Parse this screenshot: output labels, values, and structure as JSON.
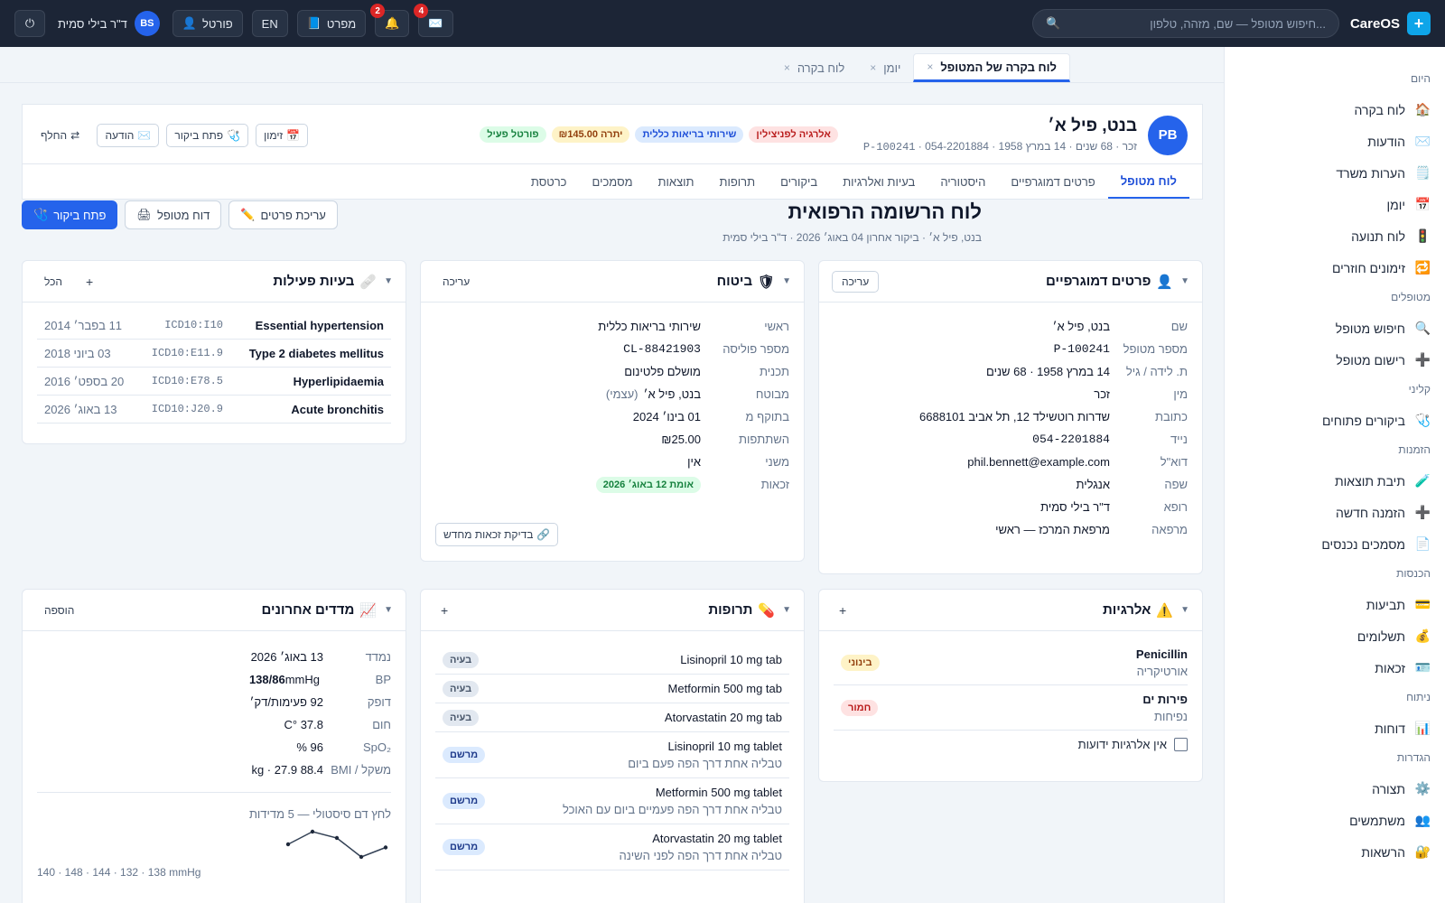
{
  "topbar": {
    "brand": "CareOS",
    "brand_logo": "plus-icon",
    "search_placeholder": "חיפוש מטופל — שם, מזהה, טלפון...",
    "messages_count": "4",
    "notifications_count": "2",
    "handbook_label": "מפרט",
    "lang_label": "EN",
    "portal_label": "פורטל",
    "user_name": "ד\"ר בילי סמית",
    "user_initials": "BS"
  },
  "window_tabs": [
    {
      "label": "לוח בקרה של המטופל",
      "active": true
    },
    {
      "label": "יומן",
      "active": false
    },
    {
      "label": "לוח בקרה",
      "active": false
    }
  ],
  "sidebar": {
    "sections": [
      {
        "title": "היום",
        "items": [
          {
            "label": "לוח בקרה",
            "icon": "🏠"
          },
          {
            "label": "הודעות",
            "icon": "✉️"
          },
          {
            "label": "הערות משרד",
            "icon": "🗒️"
          },
          {
            "label": "יומן",
            "icon": "📅"
          },
          {
            "label": "לוח תנועה",
            "icon": "🚦"
          },
          {
            "label": "זימונים חוזרים",
            "icon": "🔁"
          }
        ]
      },
      {
        "title": "מטופלים",
        "items": [
          {
            "label": "חיפוש מטופל",
            "icon": "🔍"
          },
          {
            "label": "רישום מטופל",
            "icon": "➕"
          }
        ]
      },
      {
        "title": "קליני",
        "items": [
          {
            "label": "ביקורים פתוחים",
            "icon": "🩺"
          }
        ]
      },
      {
        "title": "הזמנות",
        "items": [
          {
            "label": "תיבת תוצאות",
            "icon": "🧪"
          },
          {
            "label": "הזמנה חדשה",
            "icon": "➕"
          },
          {
            "label": "מסמכים נכנסים",
            "icon": "📄"
          }
        ]
      },
      {
        "title": "הכנסות",
        "items": [
          {
            "label": "תביעות",
            "icon": "💳"
          },
          {
            "label": "תשלומים",
            "icon": "💰"
          },
          {
            "label": "זכאות",
            "icon": "🪪"
          }
        ]
      },
      {
        "title": "ניתוח",
        "items": [
          {
            "label": "דוחות",
            "icon": "📊"
          }
        ]
      },
      {
        "title": "הגדרות",
        "items": [
          {
            "label": "תצורה",
            "icon": "⚙️"
          },
          {
            "label": "משתמשים",
            "icon": "👥"
          },
          {
            "label": "הרשאות",
            "icon": "🔐"
          }
        ]
      }
    ]
  },
  "patient": {
    "initials": "PB",
    "name": "בנט, פיל א׳",
    "sex": "זכר",
    "age": "68 שנים",
    "dob": "14 במרץ 1958",
    "mrn": "P-100241",
    "phone": "054-2201884",
    "tags": {
      "allergy": "אלרגיה לפניצילין",
      "insurer": "שירותי בריאות כללית",
      "balance": "יתרה ₪145.00",
      "portal": "פורטל פעיל"
    },
    "actions": {
      "schedule": "זימון",
      "open_visit": "פתח ביקור",
      "message": "הודעה",
      "switch": "החלף"
    }
  },
  "nav_tabs": [
    "לוח מטופל",
    "פרטים דמוגרפיים",
    "היסטוריה",
    "בעיות ואלרגיות",
    "ביקורים",
    "תרופות",
    "תוצאות",
    "מסמכים",
    "כרטסת"
  ],
  "page": {
    "title": "לוח הרשומה הרפואית",
    "subtitle": "בנט, פיל א׳ · ביקור אחרון 04 באוג׳ 2026 · ד\"ר בילי סמית",
    "edit_details": "עריכת פרטים",
    "patient_report": "דוח מטופל",
    "open_visit": "פתח ביקור"
  },
  "demographics": {
    "title": "פרטים דמוגרפיים",
    "edit": "עריכה",
    "rows": [
      {
        "k": "שם",
        "v": "בנט, פיל א׳"
      },
      {
        "k": "מספר מטופל",
        "v": "P-100241"
      },
      {
        "k": "ת. לידה / גיל",
        "v": "14 במרץ 1958 · 68 שנים"
      },
      {
        "k": "מין",
        "v": "זכר"
      },
      {
        "k": "כתובת",
        "v": "שדרות רוטשילד 12, תל אביב 6688101"
      },
      {
        "k": "נייד",
        "v": "054-2201884"
      },
      {
        "k": "דוא\"ל",
        "v": "phil.bennett@example.com"
      },
      {
        "k": "שפה",
        "v": "אנגלית"
      },
      {
        "k": "רופא",
        "v": "ד\"ר בילי סמית"
      },
      {
        "k": "מרפאה",
        "v": "מרפאת המרכז — ראשי"
      }
    ]
  },
  "insurance": {
    "title": "ביטוח",
    "edit": "עריכה",
    "rows": [
      {
        "k": "ראשי",
        "v": "שירותי בריאות כללית"
      },
      {
        "k": "מספר פוליסה",
        "v": "CL-88421903"
      },
      {
        "k": "תכנית",
        "v": "מושלם פלטינום"
      },
      {
        "k": "מבוטח",
        "v": "בנט, פיל א׳",
        "extra": "(עצמי)"
      },
      {
        "k": "בתוקף מ",
        "v": "01 בינו׳ 2024"
      },
      {
        "k": "השתתפות",
        "v": "₪25.00"
      },
      {
        "k": "משני",
        "v": "אין"
      },
      {
        "k": "זכאות",
        "v": "אומת 12 באוג׳ 2026"
      }
    ],
    "recheck": "בדיקת זכאות מחדש"
  },
  "problems": {
    "title": "בעיות פעילות",
    "all": "הכל",
    "rows": [
      {
        "name": "Essential hypertension",
        "code": "ICD10:I10",
        "date": "11 בפבר׳ 2014"
      },
      {
        "name": "Type 2 diabetes mellitus",
        "code": "ICD10:E11.9",
        "date": "03 ביוני 2018"
      },
      {
        "name": "Hyperlipidaemia",
        "code": "ICD10:E78.5",
        "date": "20 בספט׳ 2016"
      },
      {
        "name": "Acute bronchitis",
        "code": "ICD10:J20.9",
        "date": "13 באוג׳ 2026"
      }
    ]
  },
  "allergies": {
    "title": "אלרגיות",
    "rows": [
      {
        "name": "Penicillin",
        "reaction": "אורטיקריה",
        "severity": "בינוני"
      },
      {
        "name": "פירות ים",
        "reaction": "נפיחות",
        "severity": "חמור"
      }
    ],
    "nka": "אין אלרגיות ידועות"
  },
  "medications": {
    "title": "תרופות",
    "rows": [
      {
        "name": "Lisinopril 10 mg tab",
        "sig": "",
        "status": "בעיה"
      },
      {
        "name": "Metformin 500 mg tab",
        "sig": "",
        "status": "בעיה"
      },
      {
        "name": "Atorvastatin 20 mg tab",
        "sig": "",
        "status": "בעיה"
      },
      {
        "name": "Lisinopril 10 mg tablet",
        "sig": "טבליה אחת דרך הפה פעם ביום",
        "status": "מרשם"
      },
      {
        "name": "Metformin 500 mg tablet",
        "sig": "טבליה אחת דרך הפה פעמיים ביום עם האוכל",
        "status": "מרשם"
      },
      {
        "name": "Atorvastatin 20 mg tablet",
        "sig": "טבליה אחת דרך הפה לפני השינה",
        "status": "מרשם"
      }
    ]
  },
  "vitals": {
    "title": "מדדים אחרונים",
    "add": "הוספה",
    "rows": [
      {
        "k": "נמדד",
        "v": "13 באוג׳ 2026"
      },
      {
        "k": "BP",
        "v": "138/86",
        "unit": "mmHg"
      },
      {
        "k": "דופק",
        "v": "92 פעימות/דק׳"
      },
      {
        "k": "חום",
        "v": "37.8 °C"
      },
      {
        "k": "SpO₂",
        "v": "96 %"
      },
      {
        "k": "משקל / BMI",
        "v": "88.4 kg · 27.9"
      }
    ],
    "trend_title": "לחץ דם סיסטולי — 5 מדידות",
    "trend_caption": "140 · 148 · 144 · 132 · 138 mmHg",
    "trend_values": [
      140,
      148,
      144,
      132,
      138
    ]
  }
}
